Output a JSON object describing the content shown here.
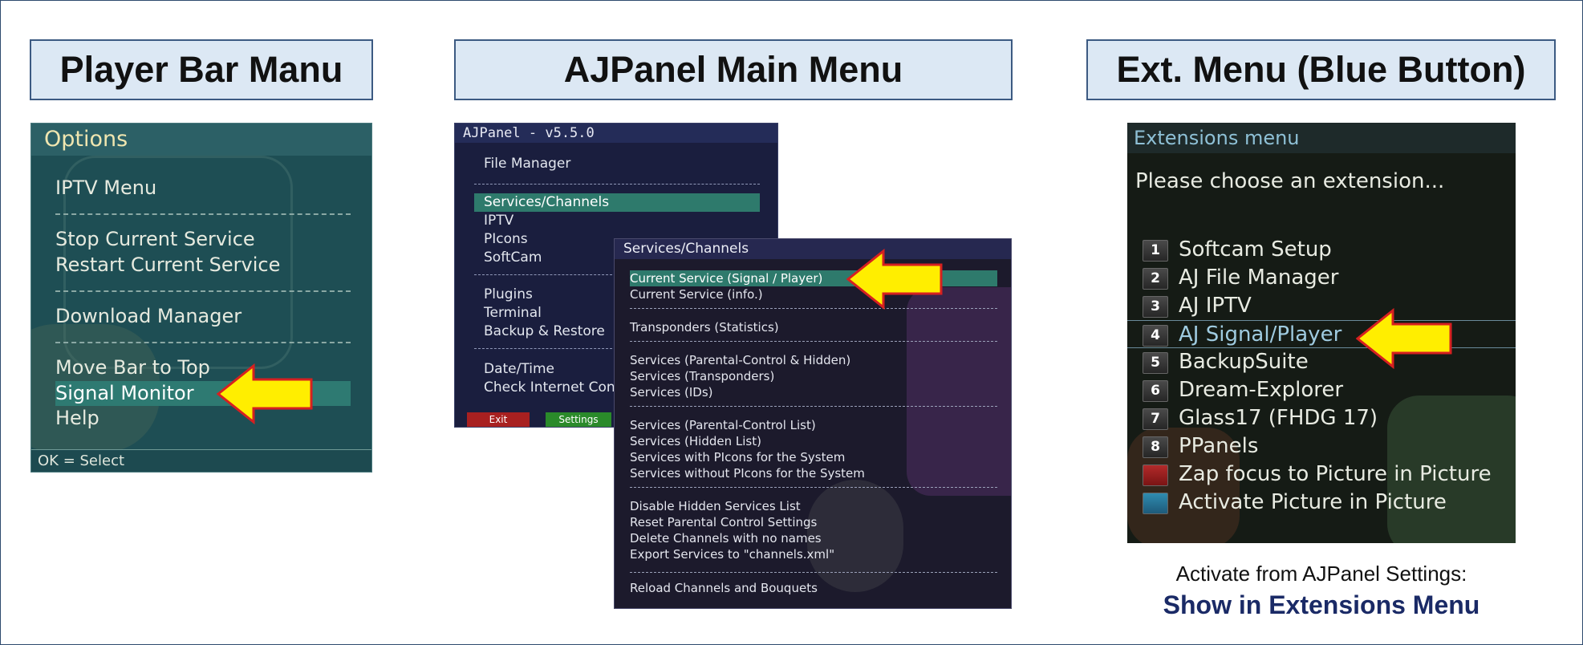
{
  "headers": {
    "player_bar": "Player Bar Manu",
    "ajpanel_main": "AJPanel Main Menu",
    "ext_menu": "Ext. Menu (Blue Button)"
  },
  "options_panel": {
    "title": "Options",
    "items": [
      "IPTV Menu",
      "Stop Current Service",
      "Restart Current Service",
      "Download Manager",
      "Move Bar to Top",
      "Signal Monitor",
      "Help"
    ],
    "selected": "Signal Monitor",
    "footer": "OK = Select"
  },
  "ajpanel": {
    "title": "AJPanel - v5.5.0",
    "items": [
      "File Manager",
      "Services/Channels",
      "IPTV",
      "PIcons",
      "SoftCam",
      "Plugins",
      "Terminal",
      "Backup & Restore",
      "Date/Time",
      "Check Internet Connection"
    ],
    "selected": "Services/Channels",
    "buttons": {
      "exit": "Exit",
      "settings": "Settings"
    }
  },
  "services_channels": {
    "title": "Services/Channels",
    "items": [
      "Current Service (Signal / Player)",
      "Current Service (info.)",
      "Transponders (Statistics)",
      "Services (Parental-Control & Hidden)",
      "Services (Transponders)",
      "Services (IDs)",
      "Services (Parental-Control List)",
      "Services (Hidden List)",
      "Services with PIcons for the System",
      "Services without PIcons for the System",
      "Disable Hidden Services List",
      "Reset Parental Control Settings",
      "Delete Channels with no names",
      "Export Services to \"channels.xml\"",
      "Reload Channels and Bouquets"
    ],
    "selected": "Current Service (Signal / Player)"
  },
  "extensions": {
    "title": "Extensions menu",
    "subtitle": "Please choose an extension...",
    "items": [
      {
        "key": "1",
        "label": "Softcam Setup"
      },
      {
        "key": "2",
        "label": "AJ File Manager"
      },
      {
        "key": "3",
        "label": "AJ IPTV"
      },
      {
        "key": "4",
        "label": "AJ Signal/Player"
      },
      {
        "key": "5",
        "label": "BackupSuite"
      },
      {
        "key": "6",
        "label": "Dream-Explorer"
      },
      {
        "key": "7",
        "label": "Glass17 (FHDG 17)"
      },
      {
        "key": "8",
        "label": "PPanels"
      },
      {
        "key": "red",
        "label": "Zap focus to Picture in Picture"
      },
      {
        "key": "blue",
        "label": "Activate Picture in Picture"
      }
    ],
    "selected": "AJ Signal/Player"
  },
  "caption": {
    "line1": "Activate from AJPanel Settings:",
    "line2": "Show in Extensions Menu"
  },
  "colors": {
    "header_bg": "#dce8f4",
    "selection": "#2e7a6c",
    "arrow_fill": "#ffee00",
    "arrow_stroke": "#d62020",
    "caption_emphasis": "#1a2a66"
  }
}
